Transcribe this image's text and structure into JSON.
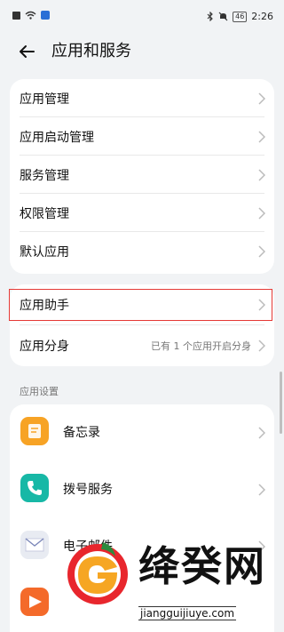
{
  "status_bar": {
    "time": "2:26",
    "battery": "46",
    "icons": [
      "notification-icon",
      "wifi-icon",
      "app-notify-icon",
      "bluetooth-icon",
      "mute-icon",
      "battery-icon"
    ]
  },
  "header": {
    "back_icon": "back-arrow-icon",
    "title": "应用和服务"
  },
  "group1": {
    "items": [
      {
        "label": "应用管理"
      },
      {
        "label": "应用启动管理"
      },
      {
        "label": "服务管理"
      },
      {
        "label": "权限管理"
      },
      {
        "label": "默认应用"
      }
    ]
  },
  "group2": {
    "items": [
      {
        "label": "应用助手",
        "value": ""
      },
      {
        "label": "应用分身",
        "value": "已有 1 个应用开启分身"
      }
    ]
  },
  "app_settings": {
    "section_title": "应用设置",
    "items": [
      {
        "label": "备忘录",
        "icon": "memo-app-icon",
        "color": "#f7a325"
      },
      {
        "label": "拨号服务",
        "icon": "phone-app-icon",
        "color": "#17b8a6"
      },
      {
        "label": "电子邮件",
        "icon": "mail-app-icon",
        "color": "#e8ebf2"
      },
      {
        "label": "",
        "icon": "video-app-icon",
        "color": "#f46a2a"
      }
    ]
  },
  "watermark": {
    "title": "绛癸网",
    "url": "jiangguijiuye.com"
  }
}
